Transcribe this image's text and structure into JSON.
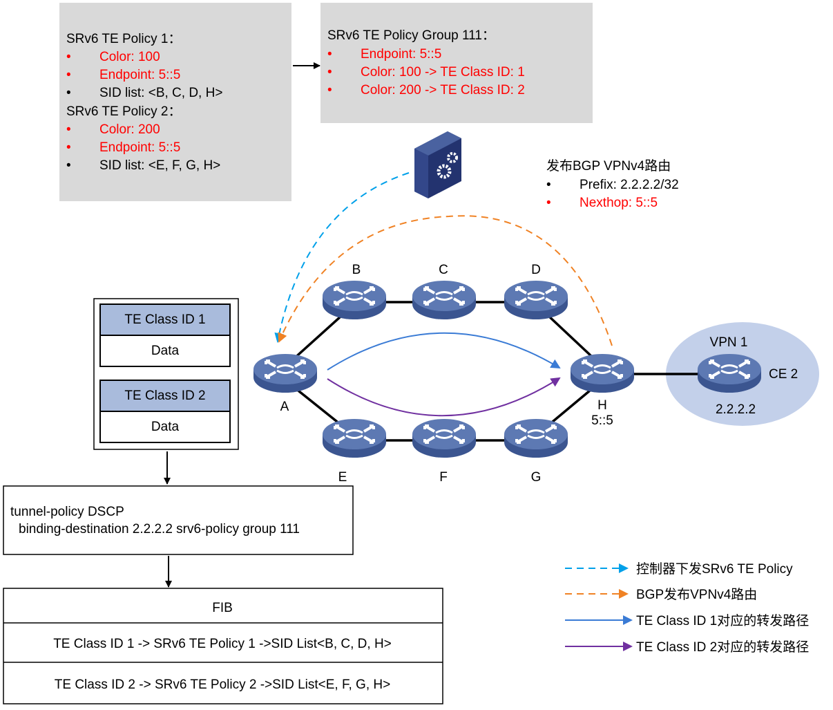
{
  "policies_box": {
    "policy1_title": "SRv6 TE Policy 1：",
    "policy1_items": [
      "Color: 100",
      "Endpoint: 5::5",
      "SID list: <B, C, D, H>"
    ],
    "policy2_title": "SRv6 TE Policy 2：",
    "policy2_items": [
      "Color: 200",
      "Endpoint: 5::5",
      "SID list: <E, F, G, H>"
    ]
  },
  "group_box": {
    "title": "SRv6 TE Policy Group 111：",
    "items": [
      "Endpoint: 5::5",
      "Color: 100 -> TE Class ID: 1",
      "Color: 200 -> TE Class ID: 2"
    ]
  },
  "bgp_note": {
    "title": "发布BGP VPNv4路由",
    "items": [
      "Prefix: 2.2.2.2/32",
      "Nexthop: 5::5"
    ]
  },
  "nodes": {
    "A": "A",
    "B": "B",
    "C": "C",
    "D": "D",
    "E": "E",
    "F": "F",
    "G": "G",
    "H": "H",
    "H_addr": "5::5"
  },
  "vpn": {
    "label": "VPN 1",
    "ce": "CE 2",
    "addr": "2.2.2.2"
  },
  "packets": [
    {
      "header": "TE Class ID 1",
      "body": "Data"
    },
    {
      "header": "TE Class ID 2",
      "body": "Data"
    }
  ],
  "tunnel_policy": {
    "line1": "tunnel-policy DSCP",
    "line2": "binding-destination 2.2.2.2 srv6-policy group 111"
  },
  "fib": {
    "title": "FIB",
    "rows": [
      "TE Class ID 1 -> SRv6 TE Policy 1 ->SID List<B, C, D, H>",
      "TE Class ID 2 -> SRv6 TE Policy 2 ->SID List<E, F, G, H>"
    ]
  },
  "legend": [
    {
      "label": "控制器下发SRv6 TE Policy",
      "color": "#00a0e9",
      "style": "dashed"
    },
    {
      "label": "BGP发布VPNv4路由",
      "color": "#f08224",
      "style": "dashed"
    },
    {
      "label": "TE Class ID 1对应的转发路径",
      "color": "#3a7bd5",
      "style": "solid"
    },
    {
      "label": "TE Class ID 2对应的转发路径",
      "color": "#7030a0",
      "style": "solid"
    }
  ],
  "colors": {
    "highlight": "#ff0000",
    "box_gray": "#d9d9d9",
    "router": "#5470a8",
    "packet_header": "#a9bbdc",
    "vpn_area": "#c3d0ea"
  }
}
